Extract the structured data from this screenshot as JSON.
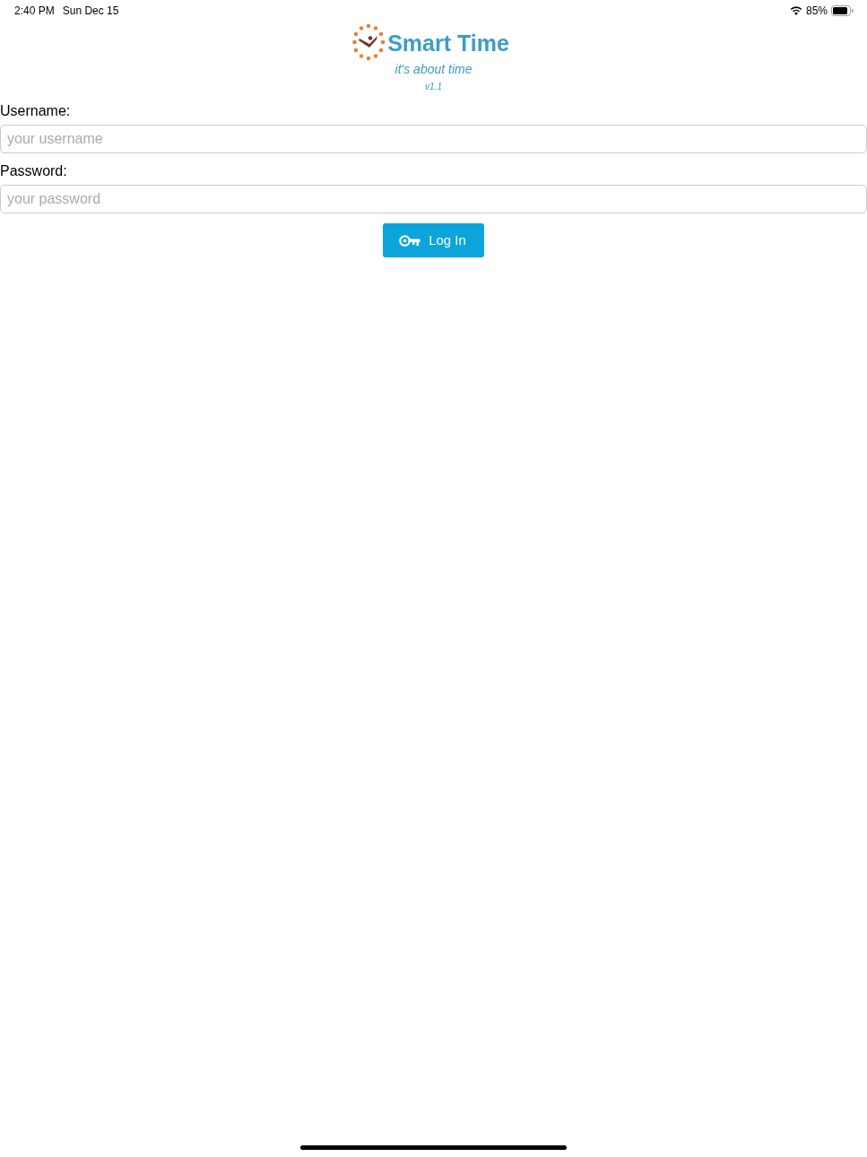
{
  "status_bar": {
    "time": "2:40 PM",
    "date": "Sun Dec 15",
    "battery": "85%"
  },
  "header": {
    "title": "Smart Time",
    "tagline": "it's about time",
    "version": "v1.1"
  },
  "fields": [
    {
      "label": "Username:",
      "placeholder": "your username"
    },
    {
      "label": "Password:",
      "placeholder": "your password"
    }
  ],
  "login_button": {
    "label": "Log In"
  }
}
